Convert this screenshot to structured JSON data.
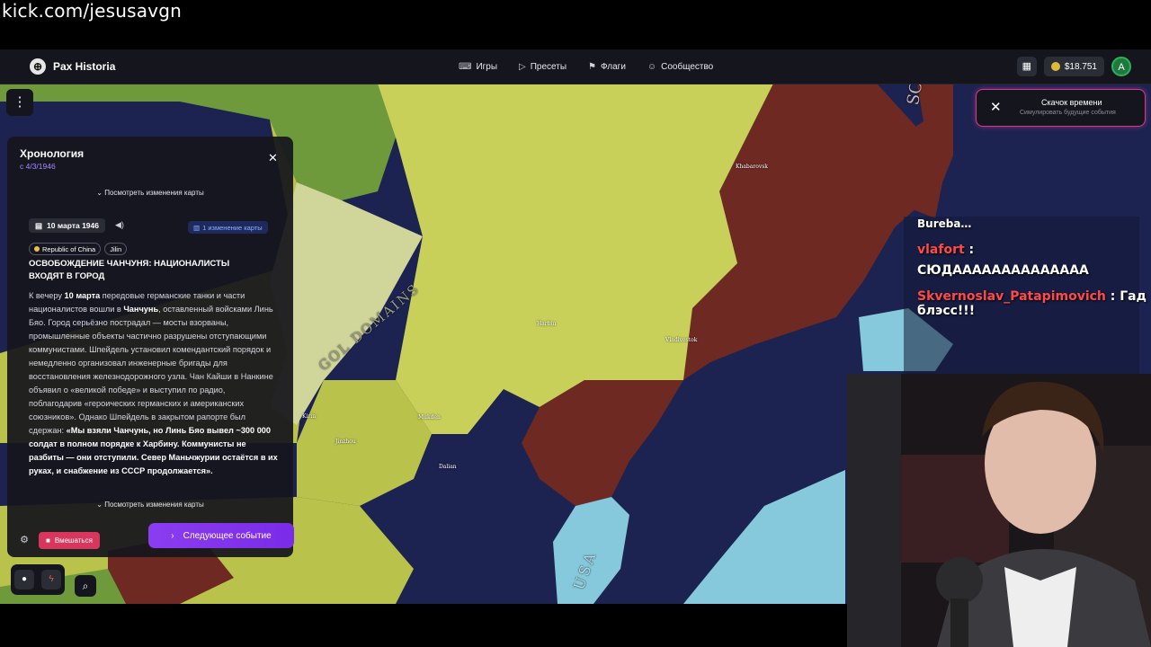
{
  "watermark": "kick.com/jesusavgn",
  "app": {
    "brand": "Pax Historia",
    "nav": [
      {
        "label": "Игры",
        "icon": "gamepad-icon"
      },
      {
        "label": "Пресеты",
        "icon": "play-icon"
      },
      {
        "label": "Флаги",
        "icon": "flag-icon"
      },
      {
        "label": "Сообщество",
        "icon": "people-icon"
      }
    ],
    "balance": "$18.751",
    "avatar_letter": "A"
  },
  "time_jump": {
    "title": "Скачок времени",
    "subtitle": "Симулировать будущие события"
  },
  "timeline": {
    "title": "Хронология",
    "since": "с 4/3/1946",
    "view_changes": "Посмотреть изменения карты",
    "event": {
      "date": "10 марта 1946",
      "map_changes": "1 изменение карты",
      "tags": [
        "Republic of China",
        "Jilin"
      ],
      "headline": "ОСВОБОЖДЕНИЕ ЧАНЧУНЯ: НАЦИОНАЛИСТЫ ВХОДЯТ В ГОРОД",
      "body_1": "К вечеру ",
      "body_b1": "10 марта",
      "body_2": " передовые германские танки и части националистов вошли в ",
      "body_b2": "Чанчунь",
      "body_3": ", оставленный войсками Линь Бяо. Город серьёзно пострадал — мосты взорваны, промышленные объекты частично разрушены отступающими коммунистами. Шпейдель установил комендантский порядок и немедленно организовал инженерные бригады для восстановления железнодорожного узла. Чан Кайши в Нанкине объявил о «великой победе» и выступил по радио, поблагодарив «героических германских и американских союзников». Однако Шпейдель в закрытом рапорте был сдержан: ",
      "body_quote": "«Мы взяли Чанчунь, но Линь Бяо вывел ~300 000 солдат в полном порядке к Харбину. Коммунисты не разбиты — они отступили. Север Маньчжурии остаётся в их руках, и снабжение из СССР продолжается»."
    },
    "intervene": "Вмешаться",
    "next_event": "Следующее событие"
  },
  "map_labels": {
    "soviet": "SOVIET U",
    "mongol": "GOL DOMAINS",
    "usa": "USA",
    "cities": [
      "Khabarovsk",
      "Harbin",
      "Vladivostok",
      "Dalian",
      "Mukden",
      "Jinzhou",
      "Kirin"
    ]
  },
  "chat": [
    {
      "user": "Bureba…",
      "text": ""
    },
    {
      "user": "vlafort",
      "text": "СЮДАААААААААААААА"
    },
    {
      "user": "Skvernoslav_Patapimovich",
      "text": "Гад блэсс!!!"
    }
  ],
  "colors": {
    "ussr": "#6e2a22",
    "china_green": "#b9c24a",
    "lime": "#c8d05a",
    "sea": "#1c2350",
    "usa": "#86c9dc",
    "mongol": "#d0d59a",
    "accent": "#8b3df0",
    "intervene": "#d9365e"
  }
}
